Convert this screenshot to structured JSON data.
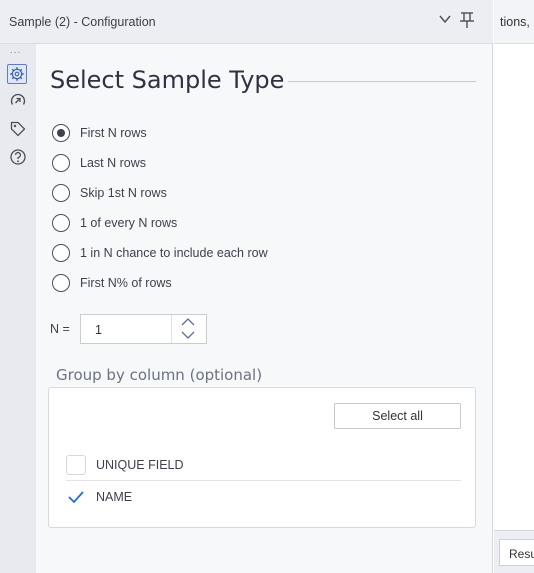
{
  "titlebar": {
    "title": "Sample (2) - Configuration",
    "chevron_icon": "chevron-down-icon",
    "pin_icon": "pin-icon"
  },
  "rail": {
    "overflow": "...",
    "icons": [
      "gear-icon",
      "navigate-icon",
      "tag-icon",
      "help-icon"
    ]
  },
  "main": {
    "heading": "Select Sample Type",
    "options": [
      {
        "label": "First N rows",
        "selected": true
      },
      {
        "label": "Last N rows",
        "selected": false
      },
      {
        "label": "Skip 1st N rows",
        "selected": false
      },
      {
        "label": "1 of every N rows",
        "selected": false
      },
      {
        "label": "1 in N chance to include each row",
        "selected": false
      },
      {
        "label": "First N% of rows",
        "selected": false
      }
    ],
    "n_label": "N =",
    "n_value": "1",
    "group_label": "Group by column (optional)",
    "select_all": "Select all",
    "fields": [
      {
        "label": "UNIQUE FIELD",
        "checked": false
      },
      {
        "label": "NAME",
        "checked": true
      }
    ]
  },
  "right": {
    "top_text": "tions,",
    "bottom_tab": "Resu"
  },
  "colors": {
    "accent": "#1f6fd0",
    "panel_bg": "#f3f4f7"
  }
}
